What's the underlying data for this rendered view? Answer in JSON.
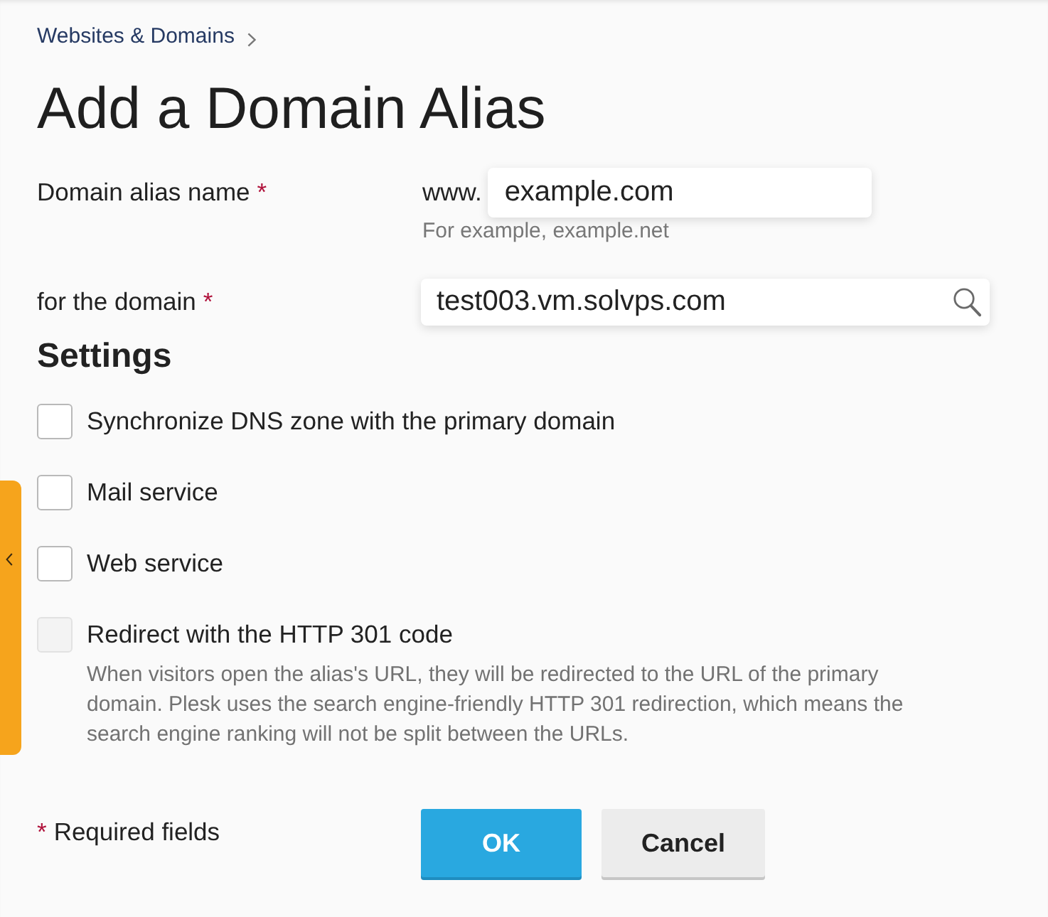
{
  "breadcrumb": [
    {
      "label": "Websites & Domains"
    }
  ],
  "title": "Add a Domain Alias",
  "fields": [
    {
      "kind": "text",
      "label": "Domain alias name",
      "required_mark": "*",
      "prefix": "www.",
      "value": "example.com",
      "hint": "For example, example.net"
    },
    {
      "kind": "search",
      "label": "for the domain",
      "required_mark": "*",
      "value": "test003.vm.solvps.com"
    }
  ],
  "settings": {
    "title": "Settings",
    "options": [
      {
        "label": "Synchronize DNS zone with the primary domain",
        "checked": false,
        "disabled": false
      },
      {
        "label": "Mail service",
        "checked": false,
        "disabled": false
      },
      {
        "label": "Web service",
        "checked": false,
        "disabled": false
      },
      {
        "label": "Redirect with the HTTP 301 code",
        "checked": false,
        "disabled": true,
        "description": "When visitors open the alias's URL, they will be redirected to the URL of the primary domain. Plesk uses the search engine-friendly HTTP 301 redirection, which means the search engine ranking will not be split between the URLs."
      }
    ]
  },
  "required_note": {
    "mark": "*",
    "text": "Required fields"
  },
  "buttons": [
    {
      "kind": "primary",
      "label": "OK"
    },
    {
      "kind": "secondary",
      "label": "Cancel"
    }
  ]
}
